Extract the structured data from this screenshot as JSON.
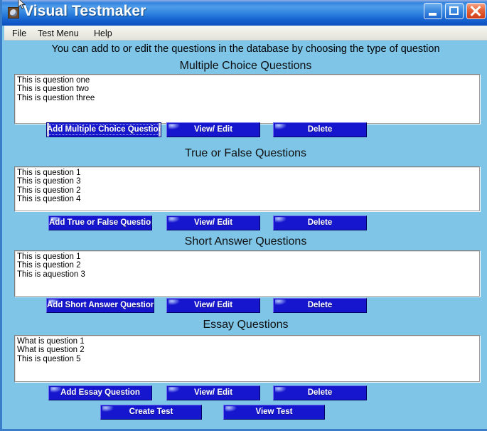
{
  "window": {
    "title": "Visual Testmaker",
    "icon": "app-icon",
    "caption_buttons": {
      "minimize": "minimize-icon",
      "maximize": "maximize-icon",
      "close": "close-icon"
    },
    "colors": {
      "titlebar_blue": "#1a68d2",
      "client_background": "#7ec5e8",
      "button_blue": "#1616cf",
      "close_red": "#cf3b17",
      "frame_border": "#3a7dc9"
    }
  },
  "menubar": {
    "items": [
      {
        "label": "File"
      },
      {
        "label": "Test Menu"
      },
      {
        "label": "Help"
      }
    ]
  },
  "main": {
    "intro_text": "You can add to or edit the questions in the database by choosing the type of question",
    "sections": [
      {
        "heading": "Multiple Choice Questions",
        "items": [
          "This is question one",
          "This is question two",
          "This is question three"
        ],
        "buttons": {
          "add": "Add Multiple Choice Question",
          "view_edit": "View/ Edit",
          "delete": "Delete"
        },
        "add_focused": true
      },
      {
        "heading": "True or False Questions",
        "items": [
          "This is question 1",
          "This is question 3",
          "This is question 2",
          "This is question 4"
        ],
        "buttons": {
          "add": "Add True or False Question",
          "view_edit": "View/ Edit",
          "delete": "Delete"
        },
        "add_focused": false
      },
      {
        "heading": "Short Answer Questions",
        "items": [
          "This is question 1",
          "This is question 2",
          "This is aquestion 3"
        ],
        "buttons": {
          "add": "Add Short Answer Question",
          "view_edit": "View/ Edit",
          "delete": "Delete"
        },
        "add_focused": false
      },
      {
        "heading": "Essay Questions",
        "items": [
          "What is question 1",
          "What is question 2",
          "This is question 5"
        ],
        "buttons": {
          "add": "Add Essay Question",
          "view_edit": "View/ Edit",
          "delete": "Delete"
        },
        "add_focused": false
      }
    ],
    "footer_buttons": {
      "create_test": "Create Test",
      "view_test": "View Test"
    }
  }
}
